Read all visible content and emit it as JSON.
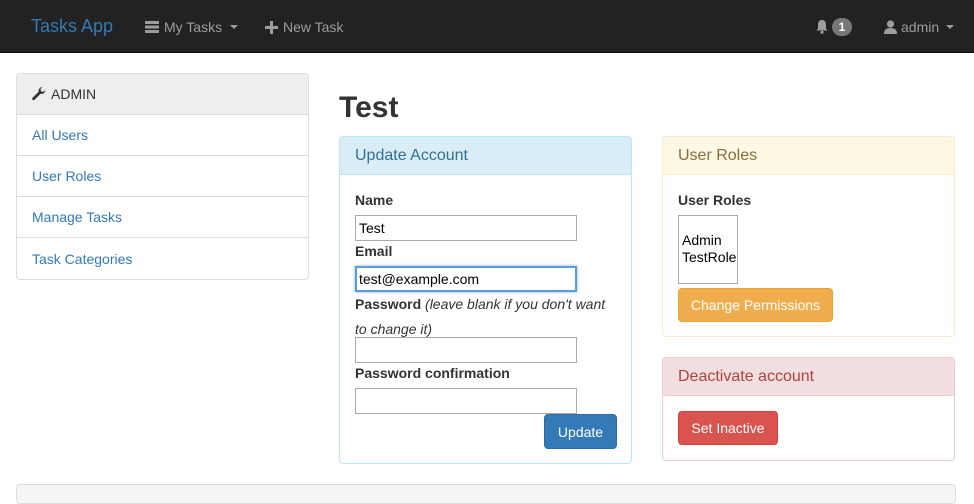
{
  "navbar": {
    "brand": "Tasks App",
    "my_tasks": "My Tasks",
    "new_task": "New Task",
    "notification_count": "1",
    "user": "admin"
  },
  "sidebar": {
    "heading": "ADMIN",
    "items": [
      {
        "label": "All Users"
      },
      {
        "label": "User Roles"
      },
      {
        "label": "Manage Tasks"
      },
      {
        "label": "Task Categories"
      }
    ]
  },
  "page": {
    "title": "Test"
  },
  "update_account": {
    "heading": "Update Account",
    "name_label": "Name",
    "name_value": "Test",
    "email_label": "Email",
    "email_value": "test@example.com",
    "password_label": "Password",
    "password_hint": "(leave blank if you don't want to change it)",
    "password_confirm_label": "Password confirmation",
    "update_button": "Update"
  },
  "user_roles": {
    "heading": "User Roles",
    "label": "User Roles",
    "roles": [
      "Admin",
      "TestRole"
    ],
    "change_permissions_button": "Change Permissions"
  },
  "deactivate": {
    "heading": "Deactivate account",
    "set_inactive_button": "Set Inactive"
  },
  "colors": {
    "navbar_bg": "#222222",
    "link": "#337ab7",
    "primary": "#337ab7",
    "warning": "#f0ad4e",
    "danger": "#d9534f"
  },
  "icons": [
    "list-icon",
    "plus-icon",
    "bell-icon",
    "user-icon",
    "wrench-icon"
  ]
}
